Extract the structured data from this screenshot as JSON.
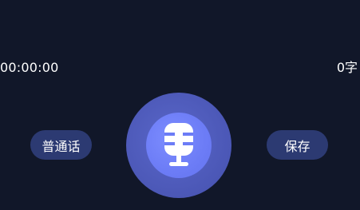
{
  "recorder": {
    "elapsed_time": "00:00:00",
    "word_count": "0字"
  },
  "controls": {
    "language_label": "普通话",
    "save_label": "保存",
    "mic_icon": "microphone-icon"
  },
  "colors": {
    "background": "#111729",
    "pill_background": "#2c3a72",
    "mic_outer": "#4b57b6",
    "mic_inner": "#6c7cf6",
    "text": "#ffffff"
  }
}
